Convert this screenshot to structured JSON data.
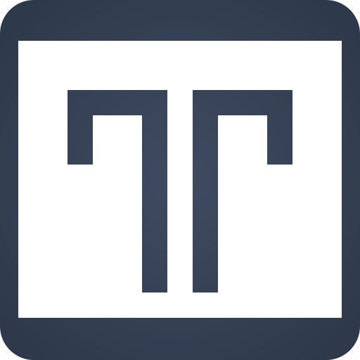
{
  "icon": {
    "name": "meander-frame-logo-icon",
    "colors": {
      "tile_light": "#3f4b60",
      "tile_dark": "#2b3648",
      "glyph": "#ffffff"
    }
  }
}
